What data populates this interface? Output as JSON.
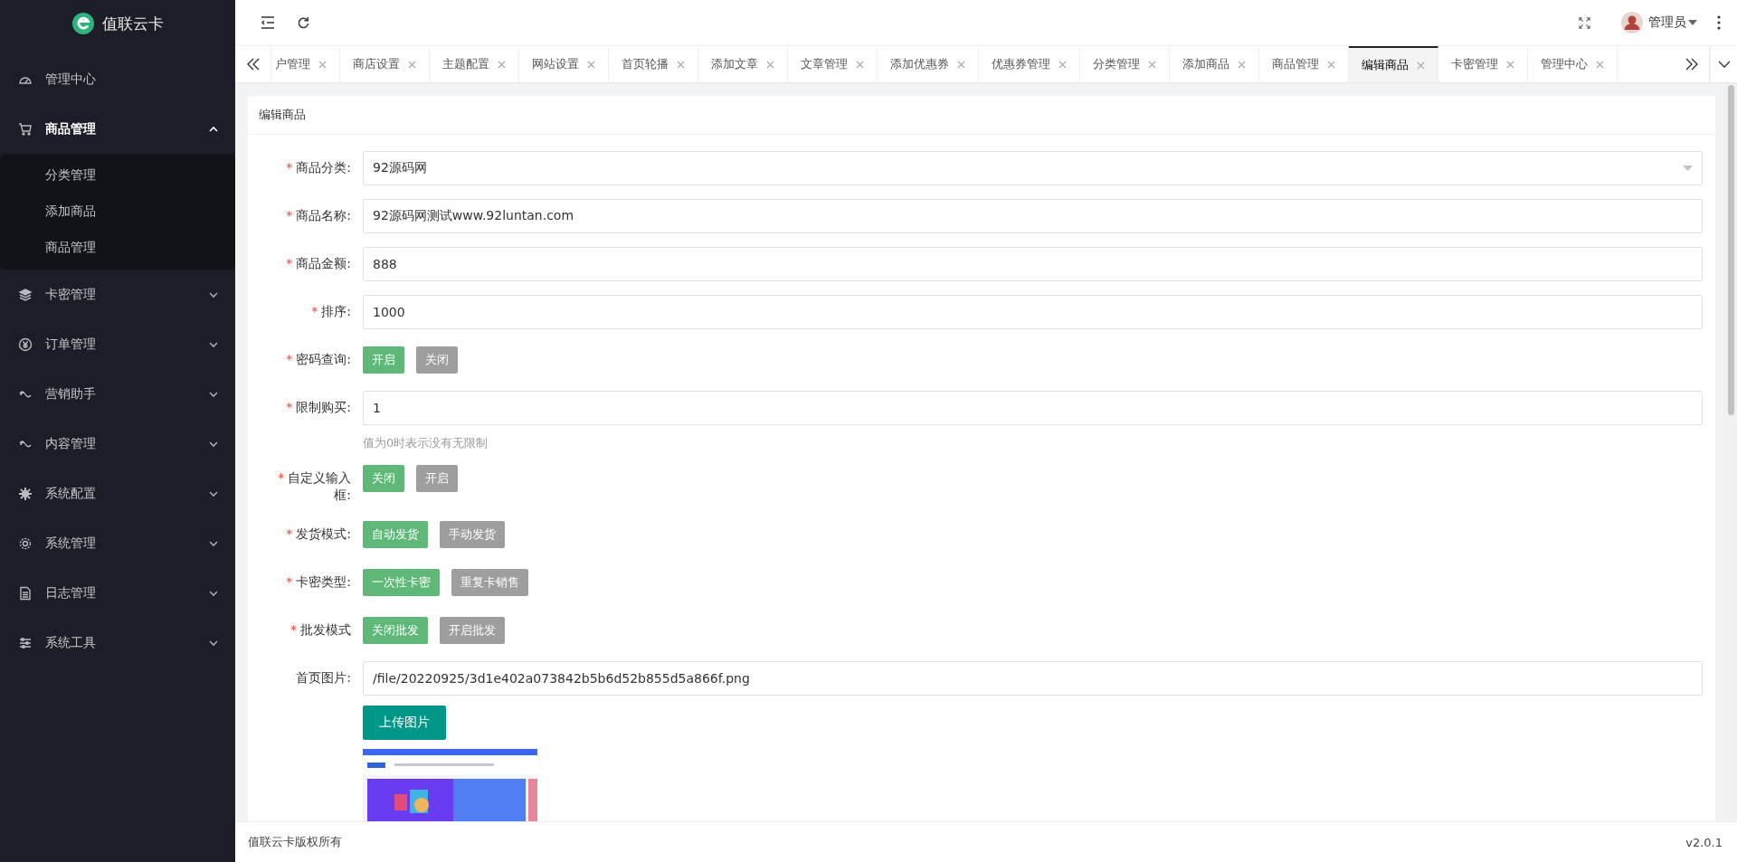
{
  "sidebar": {
    "logo": "值联云卡",
    "items": [
      {
        "label": "管理中心",
        "kind": "link",
        "expanded": false
      },
      {
        "label": "商品管理",
        "kind": "group",
        "expanded": true,
        "children": [
          {
            "label": "分类管理"
          },
          {
            "label": "添加商品"
          },
          {
            "label": "商品管理"
          }
        ]
      },
      {
        "label": "卡密管理",
        "kind": "group",
        "expanded": false
      },
      {
        "label": "订单管理",
        "kind": "group",
        "expanded": false
      },
      {
        "label": "营销助手",
        "kind": "group",
        "expanded": false
      },
      {
        "label": "内容管理",
        "kind": "group",
        "expanded": false
      },
      {
        "label": "系统配置",
        "kind": "group",
        "expanded": false
      },
      {
        "label": "系统管理",
        "kind": "group",
        "expanded": false
      },
      {
        "label": "日志管理",
        "kind": "group",
        "expanded": false
      },
      {
        "label": "系统工具",
        "kind": "group",
        "expanded": false
      }
    ]
  },
  "header": {
    "user": "管理员"
  },
  "tabs": [
    {
      "label": "户管理",
      "selected": false
    },
    {
      "label": "商店设置",
      "selected": false
    },
    {
      "label": "主题配置",
      "selected": false
    },
    {
      "label": "网站设置",
      "selected": false
    },
    {
      "label": "首页轮播",
      "selected": false
    },
    {
      "label": "添加文章",
      "selected": false
    },
    {
      "label": "文章管理",
      "selected": false
    },
    {
      "label": "添加优惠券",
      "selected": false
    },
    {
      "label": "优惠券管理",
      "selected": false
    },
    {
      "label": "分类管理",
      "selected": false
    },
    {
      "label": "添加商品",
      "selected": false
    },
    {
      "label": "商品管理",
      "selected": false
    },
    {
      "label": "编辑商品",
      "selected": true
    },
    {
      "label": "卡密管理",
      "selected": false
    },
    {
      "label": "管理中心",
      "selected": false
    }
  ],
  "card": {
    "title": "编辑商品",
    "fields": [
      {
        "kind": "select",
        "required_mark": "*",
        "label": "商品分类:",
        "value": "92源码网"
      },
      {
        "kind": "input",
        "required_mark": "*",
        "label": "商品名称:",
        "value": "92源码网测试www.92luntan.com"
      },
      {
        "kind": "input",
        "required_mark": "*",
        "label": "商品金额:",
        "value": "888"
      },
      {
        "kind": "input",
        "required_mark": "*",
        "label": "排序:",
        "value": "1000"
      },
      {
        "kind": "toggle",
        "required_mark": "*",
        "label": "密码查询:",
        "options": [
          {
            "label": "开启",
            "selected": true
          },
          {
            "label": "关闭",
            "selected": false
          }
        ]
      },
      {
        "kind": "input",
        "required_mark": "*",
        "label": "限制购买:",
        "value": "1",
        "hint": "值为0时表示没有无限制"
      },
      {
        "kind": "toggle",
        "required_mark": "*",
        "label": "自定义输入框:",
        "options": [
          {
            "label": "关闭",
            "selected": true
          },
          {
            "label": "开启",
            "selected": false
          }
        ]
      },
      {
        "kind": "toggle",
        "required_mark": "*",
        "label": "发货模式:",
        "options": [
          {
            "label": "自动发货",
            "selected": true
          },
          {
            "label": "手动发货",
            "selected": false
          }
        ]
      },
      {
        "kind": "toggle",
        "required_mark": "*",
        "label": "卡密类型:",
        "options": [
          {
            "label": "一次性卡密",
            "selected": true
          },
          {
            "label": "重复卡销售",
            "selected": false
          }
        ]
      },
      {
        "kind": "toggle",
        "required_mark": "*",
        "label": "批发模式",
        "options": [
          {
            "label": "关闭批发",
            "selected": true
          },
          {
            "label": "开启批发",
            "selected": false
          }
        ]
      },
      {
        "label": "首页图片:",
        "value": "/file/20220925/3d1e402a073842b5b6d52b855d5a866f.png",
        "button": "上传图片"
      }
    ]
  },
  "footer": {
    "copyright": "值联云卡版权所有",
    "version": "v2.0.1"
  }
}
